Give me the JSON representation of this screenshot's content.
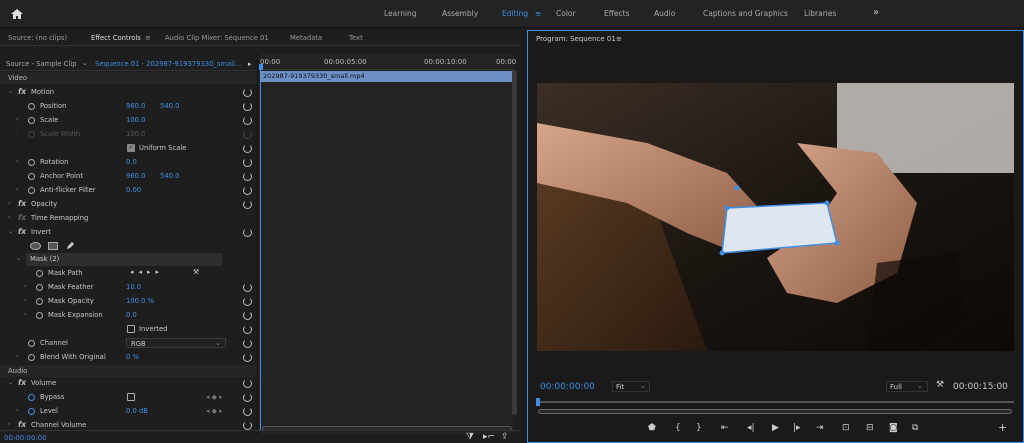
{
  "workspaces": [
    "Learning",
    "Assembly",
    "Editing",
    "Color",
    "Effects",
    "Audio",
    "Captions and Graphics",
    "Libraries"
  ],
  "left": {
    "tabs": [
      "Source: (no clips)",
      "Effect Controls",
      "Audio Clip Mixer: Sequence 01",
      "Metadata",
      "Text"
    ],
    "source_label": "Source - Sample Clip",
    "sequence_label": "Sequence 01 - 202987-919379330_small...",
    "timecodes": [
      "00:00",
      "00:00:05:00",
      "00:00:10:00",
      "00:00"
    ],
    "clip_name": "202987-919379330_small.mp4",
    "sections": {
      "video": "Video",
      "audio": "Audio"
    },
    "effects": {
      "motion": "Motion",
      "position": "Position",
      "position_x": "960.0",
      "position_y": "540.0",
      "scale": "Scale",
      "scale_v": "100.0",
      "scale_width": "Scale Width",
      "scale_width_v": "100.0",
      "uniform_scale": "Uniform Scale",
      "rotation": "Rotation",
      "rotation_v": "0.0",
      "anchor": "Anchor Point",
      "anchor_x": "960.0",
      "anchor_y": "540.0",
      "antiflicker": "Anti-flicker Filter",
      "antiflicker_v": "0.00",
      "opacity": "Opacity",
      "time_remap": "Time Remapping",
      "invert": "Invert",
      "mask": "Mask (2)",
      "mask_path": "Mask Path",
      "mask_feather": "Mask Feather",
      "mask_feather_v": "10.0",
      "mask_opacity": "Mask Opacity",
      "mask_opacity_v": "100.0 %",
      "mask_expansion": "Mask Expansion",
      "mask_expansion_v": "0.0",
      "inverted": "Inverted",
      "channel": "Channel",
      "channel_v": "RGB",
      "blend": "Blend With Original",
      "blend_v": "0 %",
      "volume": "Volume",
      "bypass": "Bypass",
      "level": "Level",
      "level_v": "0.0 dB",
      "channel_volume": "Channel Volume"
    },
    "current_time": "00:00:00:00"
  },
  "program": {
    "title": "Program: Sequence 01",
    "timecode": "00:00:00:00",
    "fit": "Fit",
    "resolution": "Full",
    "duration": "00:00:15:00"
  }
}
